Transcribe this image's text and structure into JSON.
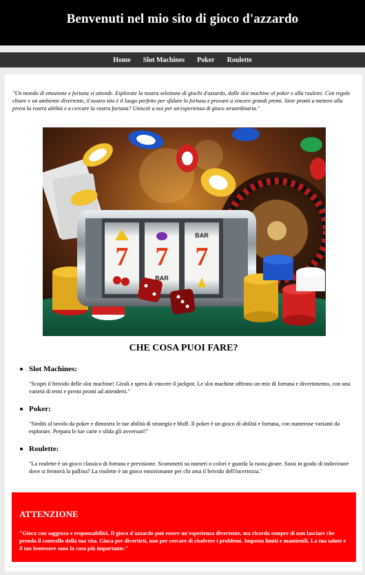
{
  "header": {
    "title": "Benvenuti nel mio sito di gioco d'azzardo"
  },
  "nav": {
    "items": [
      "Home",
      "Slot Machines",
      "Poker",
      "Roulette"
    ]
  },
  "intro": "\"Un mondo di emozione e fortuna vi attende. Esplorate la nostra selezione di giochi d'azzardo, dalle slot machine al poker e alla roulette. Con regole chiare e un ambiente divertente, il nostro sito è il luogo perfetto per sfidare la fortuna e provare a vincere grandi premi. Siete pronti a mettere alla prova la vostra abilità e a cercare la vostra fortuna? Unisciti a noi per un'esperienza di gioco straordinaria.\"",
  "hero": {
    "slot_symbols": [
      "7",
      "7",
      "7"
    ],
    "slot_top_labels": [
      "",
      "",
      "BAR"
    ],
    "slot_bottom_labels": [
      "",
      "BAR",
      ""
    ]
  },
  "section": {
    "title": "CHE COSA PUOI FARE?"
  },
  "games": [
    {
      "name": "Slot Machines:",
      "description": "\"Scopri il brivido delle slot machine! Girali e spera di vincere il jackpot. Le slot machine offrono un mix di fortuna e divertimento, con una varietà di temi e premi pronti ad attenderti.\""
    },
    {
      "name": "Poker:",
      "description": "\"Siediti al tavolo da poker e dimostra le tue abilità di strategia e bluff. Il poker è un gioco di abilità e fortuna, con numerose varianti da esplorare. Prepara le tue carte e sfida gli avversari!\""
    },
    {
      "name": "Roulette:",
      "description": "\"La roulette è un gioco classico di fortuna e previsione. Scommetti su numeri o colori e guarda la ruota girare. Sarai in grado di indovinare dove si fermerà la pallina? La roulette è un gioco emozionante per chi ama il brivido dell'incertezza.\""
    }
  ],
  "warning": {
    "title": "ATTENZIONE",
    "text": "\"Gioca con saggezza e responsabilità. Il gioco d'azzardo può essere un'esperienza divertente, ma ricorda sempre di non lasciare che prenda il controllo della tua vita. Gioca per divertirti, non per cercare di risolvere i problemi. Imposta limiti e mantienili. La tua salute e il tuo benessere sono la cosa più importante.\"",
    "background": "#ff0000"
  },
  "colors": {
    "header_bg": "#000000",
    "nav_bg": "#333333",
    "page_bg": "#ececec"
  }
}
